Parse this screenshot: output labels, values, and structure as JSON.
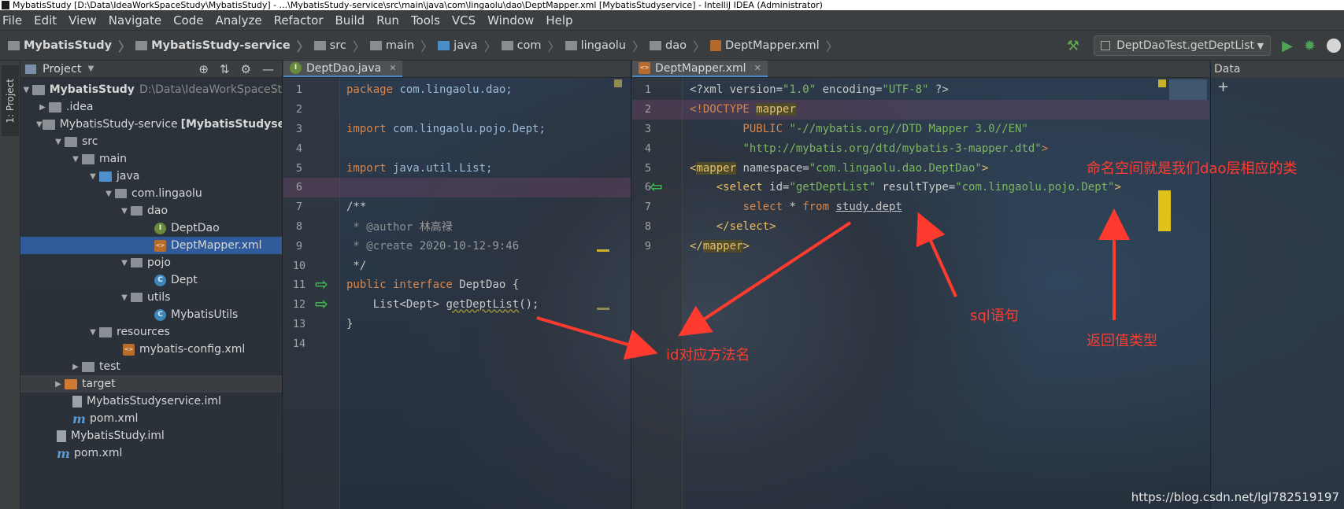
{
  "window": {
    "title": "MybatisStudy [D:\\Data\\IdeaWorkSpaceStudy\\MybatisStudy] - ...\\MybatisStudy-service\\src\\main\\java\\com\\lingaolu\\dao\\DeptMapper.xml [MybatisStudyservice] - IntelliJ IDEA (Administrator)"
  },
  "menu": [
    "File",
    "Edit",
    "View",
    "Navigate",
    "Code",
    "Analyze",
    "Refactor",
    "Build",
    "Run",
    "Tools",
    "VCS",
    "Window",
    "Help"
  ],
  "breadcrumbs": [
    "MybatisStudy",
    "MybatisStudy-service",
    "src",
    "main",
    "java",
    "com",
    "lingaolu",
    "dao",
    "DeptMapper.xml"
  ],
  "run_config": "DeptDaoTest.getDeptList",
  "project_panel": {
    "title": "Project",
    "tree": [
      {
        "label": "MybatisStudy",
        "path": "D:\\Data\\IdeaWorkSpaceSt",
        "type": "module"
      },
      {
        "label": ".idea",
        "type": "folder"
      },
      {
        "label": "MybatisStudy-service",
        "module": "[MybatisStudyse",
        "type": "module"
      },
      {
        "label": "src",
        "type": "folder"
      },
      {
        "label": "main",
        "type": "folder"
      },
      {
        "label": "java",
        "type": "folder"
      },
      {
        "label": "com.lingaolu",
        "type": "package"
      },
      {
        "label": "dao",
        "type": "package"
      },
      {
        "label": "DeptDao",
        "type": "interface"
      },
      {
        "label": "DeptMapper.xml",
        "type": "xml"
      },
      {
        "label": "pojo",
        "type": "package"
      },
      {
        "label": "Dept",
        "type": "class"
      },
      {
        "label": "utils",
        "type": "package"
      },
      {
        "label": "MybatisUtils",
        "type": "class"
      },
      {
        "label": "resources",
        "type": "folder"
      },
      {
        "label": "mybatis-config.xml",
        "type": "xml"
      },
      {
        "label": "test",
        "type": "folder"
      },
      {
        "label": "target",
        "type": "folder"
      },
      {
        "label": "MybatisStudyservice.iml",
        "type": "iml"
      },
      {
        "label": "pom.xml",
        "type": "maven"
      },
      {
        "label": "MybatisStudy.iml",
        "type": "iml"
      },
      {
        "label": "pom.xml",
        "type": "maven"
      }
    ]
  },
  "tool_strip_label": "1: Project",
  "left_editor": {
    "tab": "DeptDao.java",
    "lines": [
      {
        "n": "1"
      },
      {
        "n": "2"
      },
      {
        "n": "3"
      },
      {
        "n": "4"
      },
      {
        "n": "5"
      },
      {
        "n": "6"
      },
      {
        "n": "7"
      },
      {
        "n": "8"
      },
      {
        "n": "9"
      },
      {
        "n": "10"
      },
      {
        "n": "11"
      },
      {
        "n": "12"
      },
      {
        "n": "13"
      },
      {
        "n": "14"
      }
    ],
    "code": {
      "l1_kw": "package",
      "l1_rest": " com.lingaolu.dao;",
      "l3_kw": "import",
      "l3_rest": " com.lingaolu.pojo.Dept;",
      "l5_kw": "import",
      "l5_rest": " java.util.List;",
      "l7": "/**",
      "l8_a": " * @author ",
      "l8_b": "林高禄",
      "l9_a": " * @create ",
      "l9_b": "2020-10-12-9:46",
      "l10": " */",
      "l11_kw": "public interface",
      "l11_name": " DeptDao {",
      "l12_a": "    List<Dept> ",
      "l12_m": "getDeptList",
      "l12_c": "();",
      "l13": "}"
    }
  },
  "right_editor": {
    "tab": "DeptMapper.xml",
    "lines": [
      {
        "n": "1"
      },
      {
        "n": "2"
      },
      {
        "n": "3"
      },
      {
        "n": "4"
      },
      {
        "n": "5"
      },
      {
        "n": "6"
      },
      {
        "n": "7"
      },
      {
        "n": "8"
      },
      {
        "n": "9"
      }
    ],
    "code": {
      "l1_a": "<?xml version=",
      "l1_b": "\"1.0\"",
      "l1_c": " encoding=",
      "l1_d": "\"UTF-8\"",
      "l1_e": " ?>",
      "l2_a": "<!DOCTYPE ",
      "l2_b": "mapper",
      "l3_a": "        PUBLIC ",
      "l3_b": "\"-//mybatis.org//DTD Mapper 3.0//EN\"",
      "l4_a": "        ",
      "l4_b": "\"http://mybatis.org/dtd/mybatis-3-mapper.dtd\"",
      "l4_c": ">",
      "l5_a": "<",
      "l5_b": "mapper",
      "l5_c": " namespace=",
      "l5_d": "\"com.lingaolu.dao.DeptDao\"",
      "l5_e": ">",
      "l6_a": "    <",
      "l6_b": "select",
      "l6_c": " id=",
      "l6_d": "\"getDeptList\"",
      "l6_e": " resultType=",
      "l6_f": "\"com.lingaolu.pojo.Dept\"",
      "l6_g": ">",
      "l7_a": "        ",
      "l7_b": "select",
      "l7_c": " * ",
      "l7_d": "from",
      "l7_e": " ",
      "l7_f": "study.dept",
      "l8_a": "    </",
      "l8_b": "select",
      "l8_c": ">",
      "l9_a": "</",
      "l9_b": "mapper",
      "l9_c": ">"
    }
  },
  "right_strip_header": "Data",
  "annotations": {
    "namespace": "命名空间就是我们dao层相应的类",
    "sql": "sql语句",
    "return_type": "返回值类型",
    "id_method": "id对应方法名"
  },
  "watermark": "https://blog.csdn.net/lgl782519197",
  "colors": {
    "annotation": "#ff3b2f",
    "selection": "#2f5b9a",
    "string": "#7bb663",
    "keyword": "#d8864b",
    "tag": "#e8bf6a"
  }
}
